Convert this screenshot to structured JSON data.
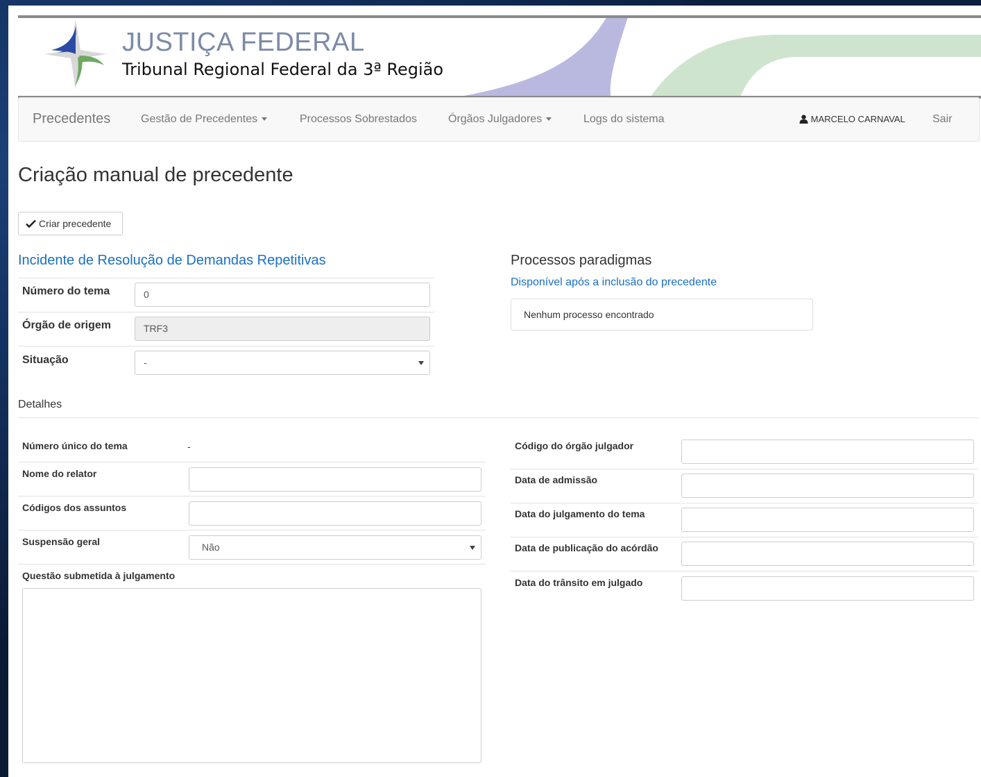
{
  "brand": {
    "title": "JUSTIÇA FEDERAL",
    "subtitle": "Tribunal Regional Federal da 3ª Região",
    "colors": {
      "purple": "#b9b9e0",
      "green": "#cfe4cf",
      "logo_blue": "#2a4aa5",
      "logo_green": "#6ea863"
    }
  },
  "navbar": {
    "brand": "Precedentes",
    "items": [
      {
        "label": "Gestão de Precedentes",
        "dropdown": true
      },
      {
        "label": "Processos Sobrestados",
        "dropdown": false
      },
      {
        "label": "Órgãos Julgadores",
        "dropdown": true
      },
      {
        "label": "Logs do sistema",
        "dropdown": false
      }
    ],
    "user": "MARCELO CARNAVAL",
    "logout": "Sair"
  },
  "page": {
    "title": "Criação manual de precedente",
    "create_button": "Criar precedente"
  },
  "incidente": {
    "title": "Incidente de Resolução de Demandas Repetitivas",
    "numero_tema_label": "Número do tema",
    "numero_tema_value": "0",
    "orgao_origem_label": "Órgão de origem",
    "orgao_origem_value": "TRF3",
    "situacao_label": "Situação",
    "situacao_value": "-"
  },
  "paradigmas": {
    "title": "Processos paradigmas",
    "subtitle": "Disponível após a inclusão do precedente",
    "empty": "Nenhum processo encontrado"
  },
  "detalhes": {
    "title": "Detalhes",
    "numero_unico_label": "Número único do tema",
    "numero_unico_value": "-",
    "nome_relator_label": "Nome do relator",
    "codigos_assuntos_label": "Códigos dos assuntos",
    "suspensao_label": "Suspensão geral",
    "suspensao_value": "Não",
    "questao_label": "Questão submetida à julgamento",
    "codigo_orgao_label": "Código do órgão julgador",
    "data_admissao_label": "Data de admissão",
    "data_julgamento_label": "Data do julgamento do tema",
    "data_publicacao_label": "Data de publicação do acórdão",
    "data_transito_label": "Data do trânsito em julgado"
  }
}
